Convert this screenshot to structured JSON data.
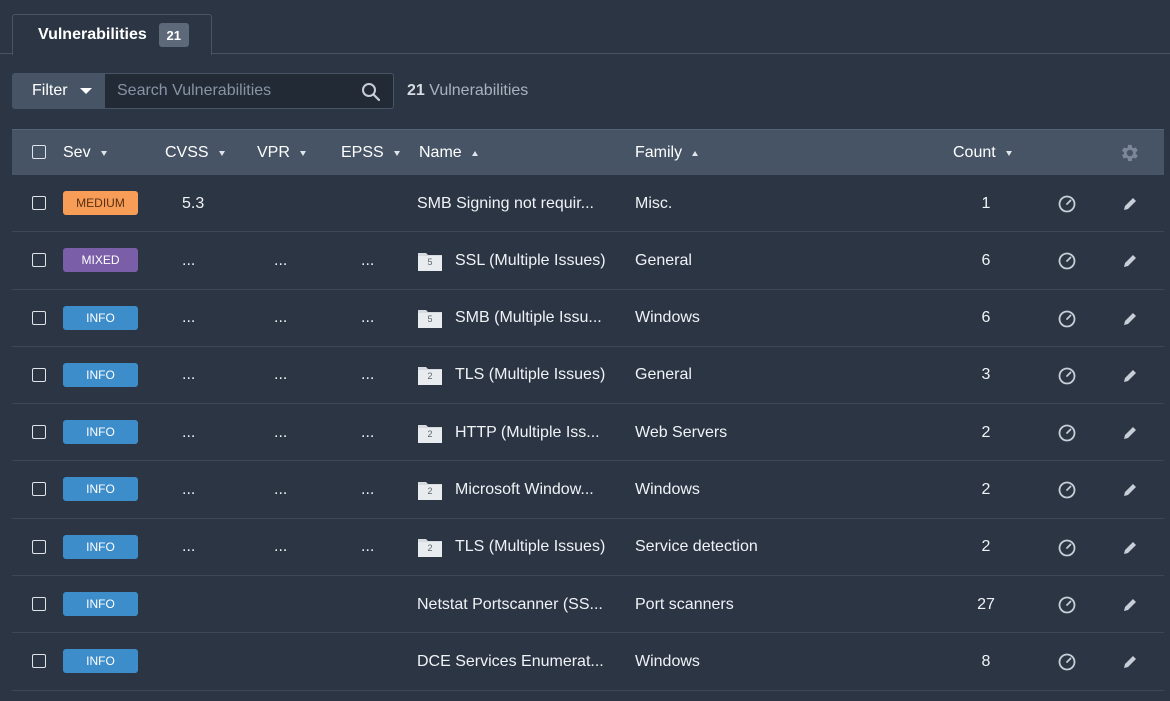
{
  "tabs": [
    {
      "label": "Vulnerabilities",
      "badge": "21"
    }
  ],
  "toolbar": {
    "filter_label": "Filter",
    "search_placeholder": "Search Vulnerabilities",
    "result_count": "21",
    "result_label": "Vulnerabilities"
  },
  "table": {
    "columns": {
      "sev": "Sev",
      "cvss": "CVSS",
      "vpr": "VPR",
      "epss": "EPSS",
      "name": "Name",
      "family": "Family",
      "count": "Count"
    },
    "rows": [
      {
        "sev": "MEDIUM",
        "sev_class": "medium",
        "cvss": "5.3",
        "vpr": "",
        "epss": "",
        "group_count": "",
        "name": "SMB Signing not requir...",
        "family": "Misc.",
        "count": "1"
      },
      {
        "sev": "MIXED",
        "sev_class": "mixed",
        "cvss": "...",
        "vpr": "...",
        "epss": "...",
        "group_count": "5",
        "name": "SSL (Multiple Issues)",
        "family": "General",
        "count": "6"
      },
      {
        "sev": "INFO",
        "sev_class": "info",
        "cvss": "...",
        "vpr": "...",
        "epss": "...",
        "group_count": "5",
        "name": "SMB (Multiple Issu...",
        "family": "Windows",
        "count": "6"
      },
      {
        "sev": "INFO",
        "sev_class": "info",
        "cvss": "...",
        "vpr": "...",
        "epss": "...",
        "group_count": "2",
        "name": "TLS (Multiple Issues)",
        "family": "General",
        "count": "3"
      },
      {
        "sev": "INFO",
        "sev_class": "info",
        "cvss": "...",
        "vpr": "...",
        "epss": "...",
        "group_count": "2",
        "name": "HTTP (Multiple Iss...",
        "family": "Web Servers",
        "count": "2"
      },
      {
        "sev": "INFO",
        "sev_class": "info",
        "cvss": "...",
        "vpr": "...",
        "epss": "...",
        "group_count": "2",
        "name": "Microsoft Window...",
        "family": "Windows",
        "count": "2"
      },
      {
        "sev": "INFO",
        "sev_class": "info",
        "cvss": "...",
        "vpr": "...",
        "epss": "...",
        "group_count": "2",
        "name": "TLS (Multiple Issues)",
        "family": "Service detection",
        "count": "2"
      },
      {
        "sev": "INFO",
        "sev_class": "info",
        "cvss": "",
        "vpr": "",
        "epss": "",
        "group_count": "",
        "name": "Netstat Portscanner (SS...",
        "family": "Port scanners",
        "count": "27"
      },
      {
        "sev": "INFO",
        "sev_class": "info",
        "cvss": "",
        "vpr": "",
        "epss": "",
        "group_count": "",
        "name": "DCE Services Enumerat...",
        "family": "Windows",
        "count": "8"
      }
    ]
  },
  "colors": {
    "medium": "#f79d57",
    "mixed": "#7a5ea7",
    "info": "#3e8dcb",
    "background": "#2b3544",
    "header": "#465466"
  }
}
